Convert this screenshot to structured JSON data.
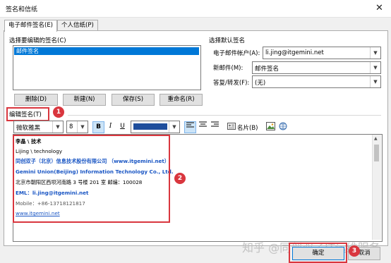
{
  "window": {
    "title": "签名和信纸",
    "close_glyph": "✕"
  },
  "tabs": [
    {
      "label": "电子邮件签名(E)"
    },
    {
      "label": "个人信纸(P)"
    }
  ],
  "select_signature": {
    "label": "选择要编辑的签名(C)",
    "items": [
      "邮件签名"
    ],
    "selected_index": 0
  },
  "signature_buttons": {
    "delete": "删除(D)",
    "new": "新建(N)",
    "save": "保存(S)",
    "rename": "重命名(R)"
  },
  "defaults": {
    "heading": "选择默认签名",
    "account_label": "电子邮件帐户(A):",
    "account_value": "li.jing@itgemini.net",
    "new_messages_label": "新邮件(M):",
    "new_messages_value": "邮件签名",
    "replies_label": "答复/转发(F):",
    "replies_value": "(无)"
  },
  "editor": {
    "label": "编辑签名(T)",
    "font": "微软雅黑",
    "size": "8",
    "bold": "B",
    "italic": "I",
    "underline": "U",
    "font_color": "#1f4e9c",
    "business_card": "名片(B)",
    "lines": [
      "李晶 \\ 技术",
      "Lijing \\ technology",
      "同创双子（北京）信息技术股份有限公司 （www.itgemini.net）",
      "Gemini Union(Beijing) Information Technology Co., Ltd.",
      "北京市朝阳区西坝河南路 3 号楼 201 室 邮编：100028",
      "EML：li.jing@itgemini.net",
      "Mobile：+86-13718121817",
      "www.itgemini.net"
    ]
  },
  "footer": {
    "ok": "确定",
    "cancel": "取消"
  },
  "annotations": {
    "badge1": "1",
    "badge2": "2",
    "badge3": "3"
  },
  "watermark": "知乎 @同创双子IT运维服务",
  "colors": {
    "annotation_red": "#d9363e",
    "selection_blue": "#0078d7",
    "link_blue": "#1a56c4"
  }
}
